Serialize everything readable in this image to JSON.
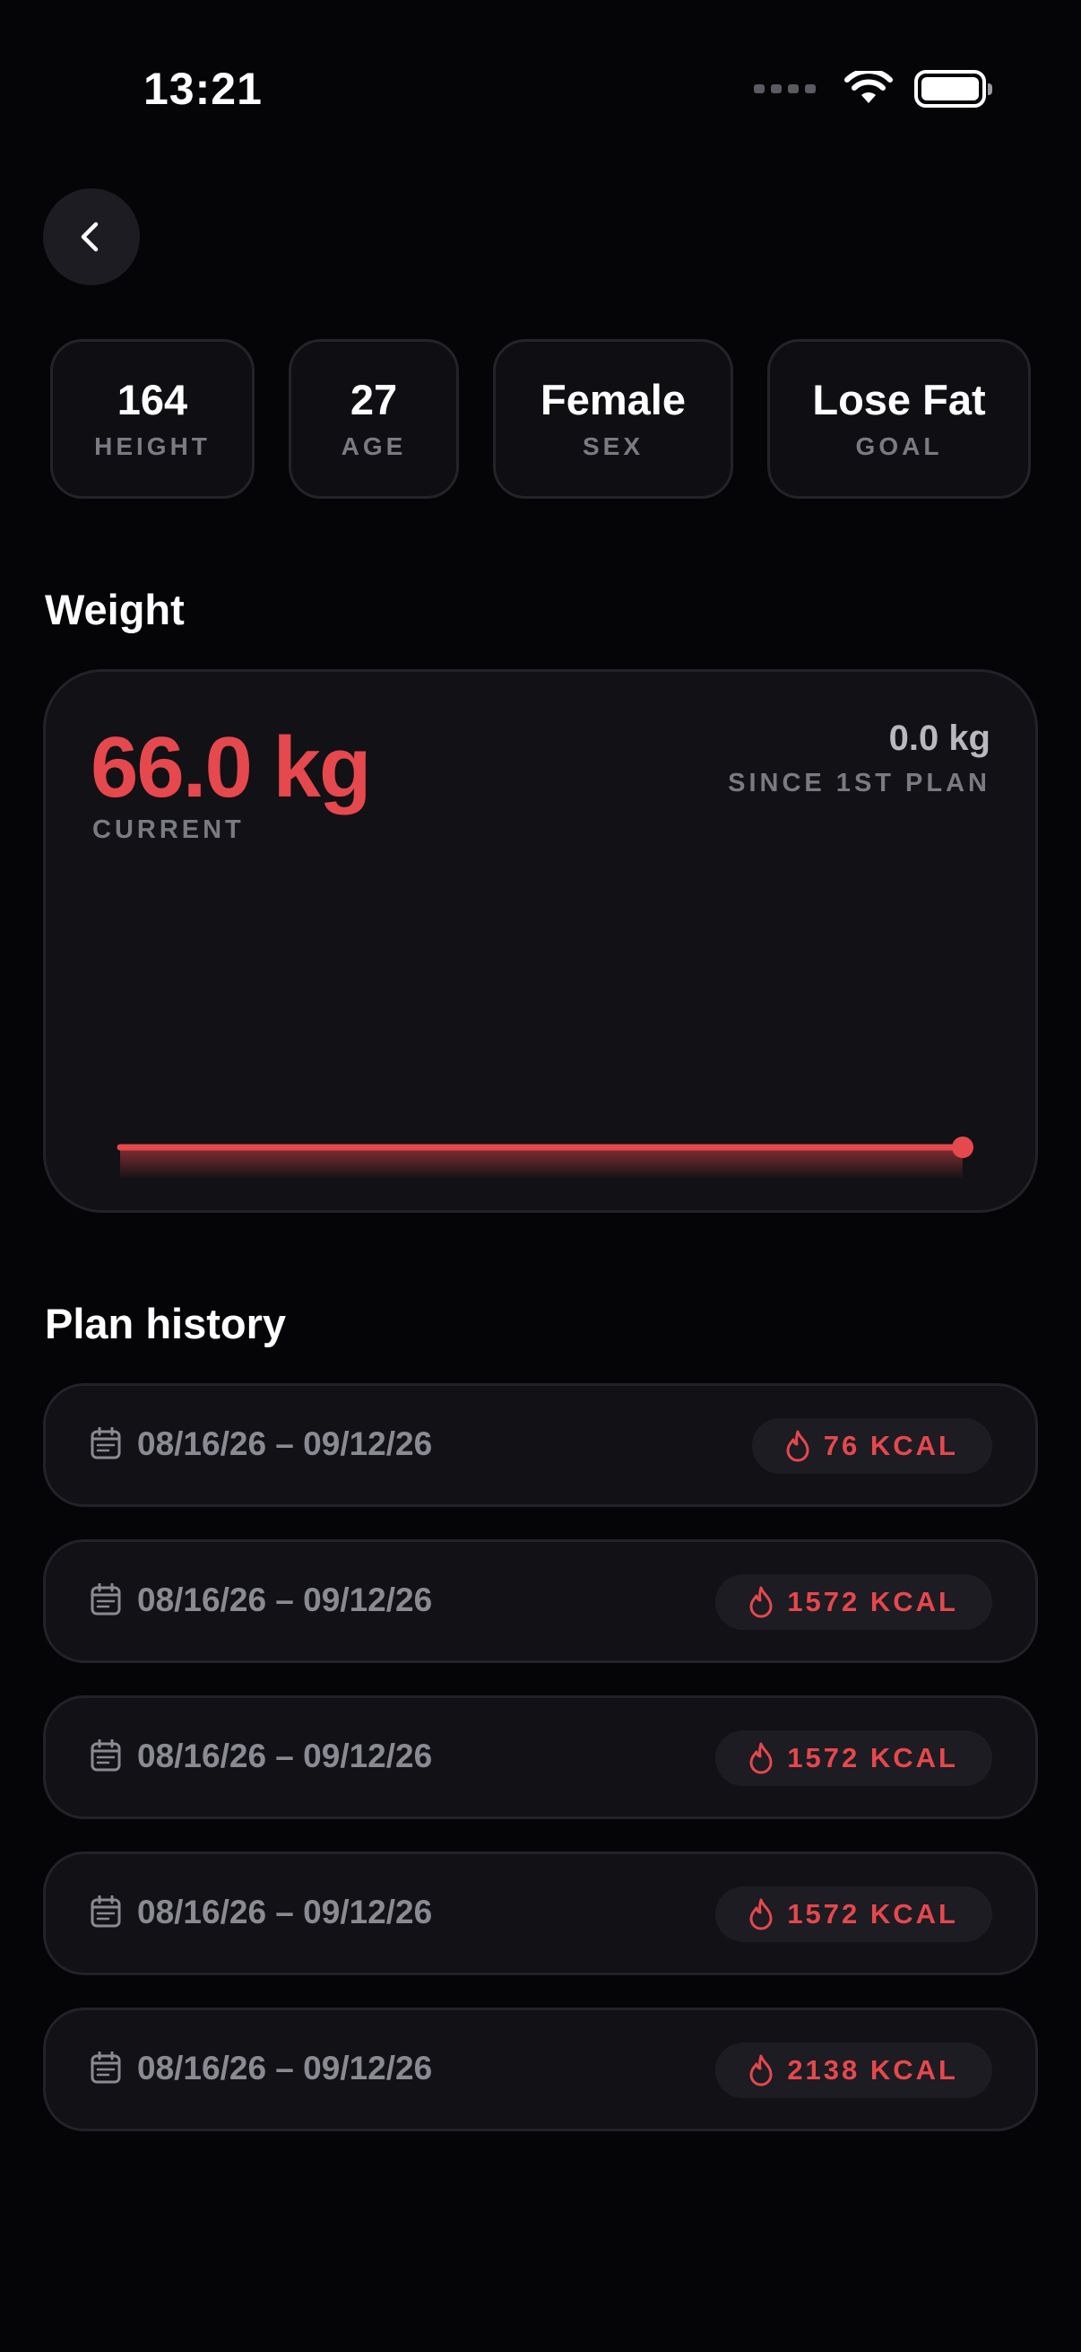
{
  "status_bar": {
    "time": "13:21"
  },
  "profile": {
    "chips": [
      {
        "value": "164",
        "label": "HEIGHT"
      },
      {
        "value": "27",
        "label": "AGE"
      },
      {
        "value": "Female",
        "label": "SEX"
      },
      {
        "value": "Lose Fat",
        "label": "GOAL"
      }
    ]
  },
  "weight": {
    "section_title": "Weight",
    "current_value": "66.0 kg",
    "current_label": "CURRENT",
    "delta_value": "0.0 kg",
    "delta_label": "SINCE 1ST PLAN"
  },
  "chart_data": {
    "type": "area",
    "x": [
      1,
      2
    ],
    "series": [
      {
        "values": [
          66.0,
          66.0
        ]
      }
    ],
    "grid": false,
    "color": "#e5484d"
  },
  "plan_history": {
    "section_title": "Plan history",
    "items": [
      {
        "date_range": "08/16/26 – 09/12/26",
        "kcal": "76 KCAL"
      },
      {
        "date_range": "08/16/26 – 09/12/26",
        "kcal": "1572 KCAL"
      },
      {
        "date_range": "08/16/26 – 09/12/26",
        "kcal": "1572 KCAL"
      },
      {
        "date_range": "08/16/26 – 09/12/26",
        "kcal": "1572 KCAL"
      },
      {
        "date_range": "08/16/26 – 09/12/26",
        "kcal": "2138 KCAL"
      }
    ]
  },
  "icons": {
    "back": "chevron-left-icon",
    "calendar": "calendar-icon",
    "flame": "flame-icon",
    "wifi": "wifi-icon",
    "battery": "battery-icon"
  },
  "colors": {
    "accent": "#e5484d",
    "background": "#050507",
    "card": "#111116",
    "muted_text": "#7a7a82"
  }
}
